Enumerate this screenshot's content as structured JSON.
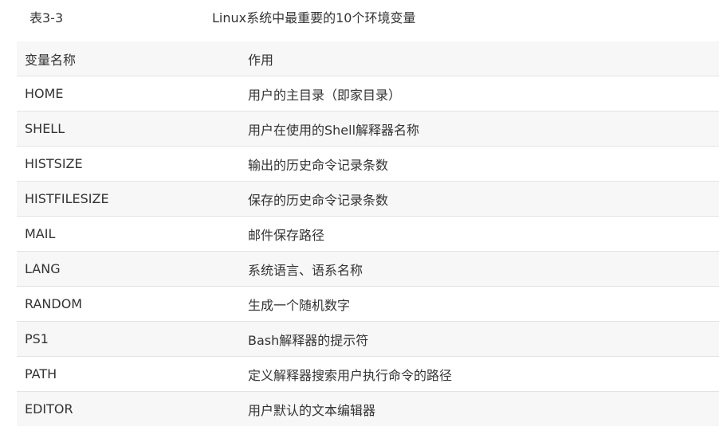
{
  "caption": {
    "label": "表3-3",
    "title": "Linux系统中最重要的10个环境变量"
  },
  "table": {
    "headers": [
      "变量名称",
      "作用"
    ],
    "rows": [
      [
        "HOME",
        "用户的主目录（即家目录）"
      ],
      [
        "SHELL",
        "用户在使用的Shell解释器名称"
      ],
      [
        "HISTSIZE",
        "输出的历史命令记录条数"
      ],
      [
        "HISTFILESIZE",
        "保存的历史命令记录条数"
      ],
      [
        "MAIL",
        "邮件保存路径"
      ],
      [
        "LANG",
        "系统语言、语系名称"
      ],
      [
        "RANDOM",
        "生成一个随机数字"
      ],
      [
        "PS1",
        "Bash解释器的提示符"
      ],
      [
        "PATH",
        "定义解释器搜索用户执行命令的路径"
      ],
      [
        "EDITOR",
        "用户默认的文本编辑器"
      ]
    ]
  },
  "colors": {
    "text": "#333333",
    "stripe": "#f7f7f7",
    "divider": "#e3e3e3"
  }
}
